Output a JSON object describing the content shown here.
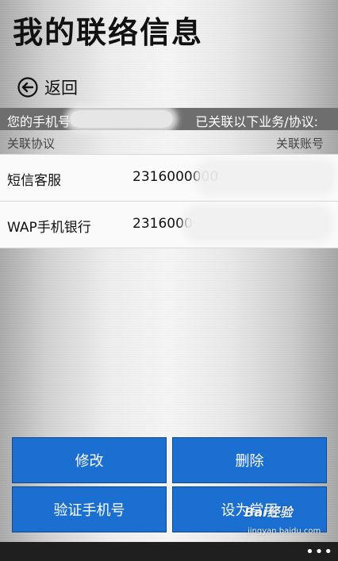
{
  "page": {
    "title": "我的联络信息",
    "back_label": "返回"
  },
  "info_bar": {
    "prefix": "您的手机号",
    "suffix": "已关联以下业务/协议:"
  },
  "table": {
    "headers": {
      "protocol": "关联协议",
      "account": "关联账号"
    },
    "rows": [
      {
        "protocol": "短信客服",
        "account": "2316000000"
      },
      {
        "protocol": "WAP手机银行",
        "account": "2316000"
      }
    ]
  },
  "actions": {
    "edit": "修改",
    "delete": "删除",
    "verify_phone": "验证手机号",
    "set_default": "设为常用"
  },
  "app_bar": {
    "more": "•••"
  },
  "watermark": {
    "logo": "Bai经验",
    "url": "jingyan.baidu.com"
  },
  "colors": {
    "button_blue": "#1a6fd1",
    "info_bar_gray": "#6e6e6e",
    "app_bar": "#1f1f1f"
  }
}
